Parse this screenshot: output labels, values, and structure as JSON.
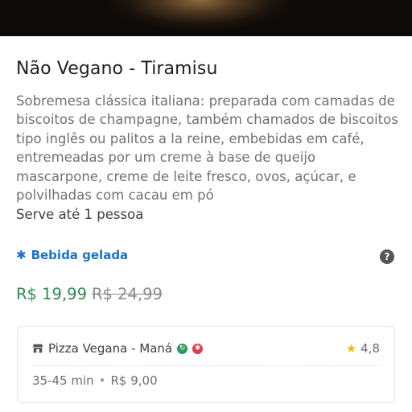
{
  "product": {
    "title": "Não Vegano - Tiramisu",
    "description": "Sobremesa clássica italiana: preparada com camadas de biscoitos de champagne, também chamados de biscoitos tipo inglês ou palitos a la reine, embebidas em café, entremeadas por um creme à base de queijo mascarpone, creme de leite fresco, ovos, açúcar, e polvilhadas com cacau em pó",
    "serves": "Serve até 1 pessoa",
    "tag": {
      "label": "Bebida gelada",
      "icon": "snowflake-icon",
      "color": "#1a73c8"
    },
    "help_icon": "question-icon",
    "price_now": "R$ 19,99",
    "price_old": "R$ 24,99",
    "price_color": "#2e8b57"
  },
  "store": {
    "name": "Pizza Vegana - Maná",
    "rating": "4,8",
    "delivery_time": "35-45 min",
    "separator": "•",
    "delivery_fee": "R$ 9,00",
    "icons": [
      "store-icon",
      "green-badge-icon",
      "red-badge-icon",
      "star-icon"
    ]
  }
}
